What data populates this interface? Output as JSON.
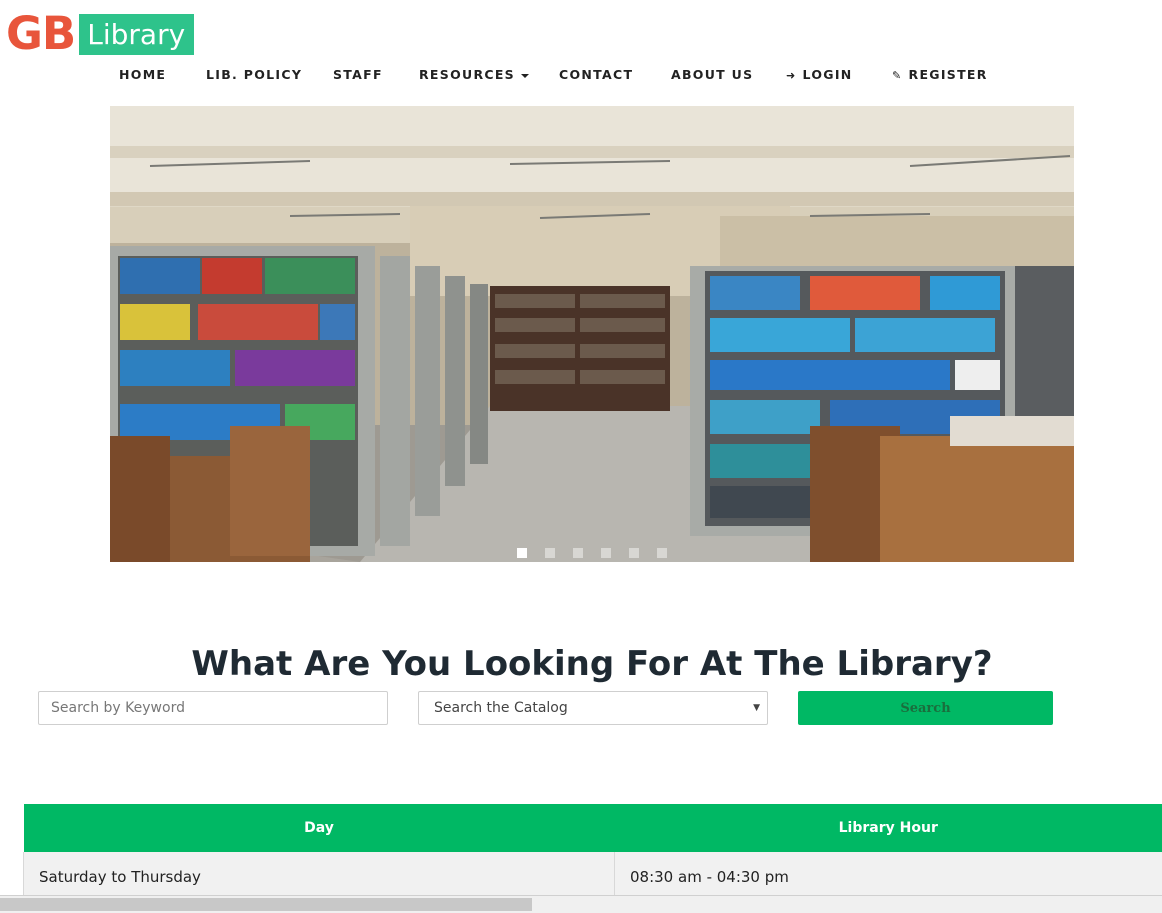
{
  "logo": {
    "gb": "GB",
    "library": "Library",
    "gb_color": "#e8553b",
    "library_bg": "#2ec38b"
  },
  "nav": {
    "home": "HOME",
    "policy": "LIB. POLICY",
    "staff": "STAFF",
    "resources": "RESOURCES",
    "contact": "CONTACT",
    "about": "ABOUT US",
    "login": "LOGIN",
    "register": "REGISTER",
    "login_icon": "sign-in-icon",
    "register_icon": "edit-icon"
  },
  "carousel": {
    "slide_count": 6,
    "active_index": 0,
    "image": "library-bookshelves-photo"
  },
  "search": {
    "heading": "What Are You Looking For At The Library?",
    "keyword_placeholder": "Search by Keyword",
    "catalog_selected": "Search the Catalog",
    "button_label": "Search"
  },
  "hours": {
    "columns": [
      "Day",
      "Library Hour"
    ],
    "rows": [
      [
        "Saturday to Thursday",
        "08:30 am - 04:30 pm"
      ]
    ]
  },
  "colors": {
    "accent_green": "#00b864",
    "heading": "#1f2a33"
  }
}
